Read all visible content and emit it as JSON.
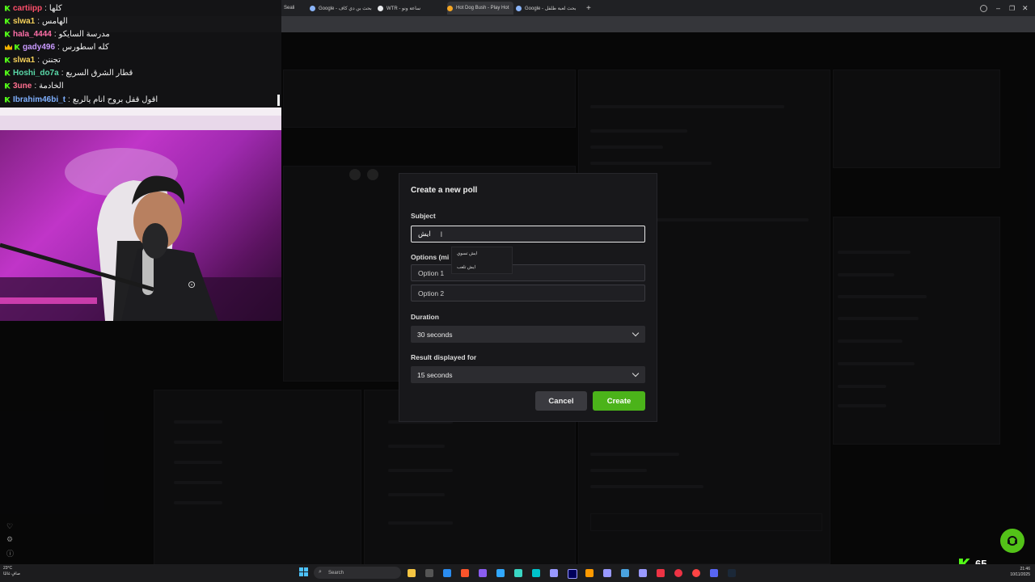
{
  "browser": {
    "tabs": [
      {
        "label": "Google - بحث بن دي كاف"
      },
      {
        "label": "WTR - ساعة ونو"
      },
      {
        "label": "Hot Dog Bush - Play Hot"
      },
      {
        "label": "Google - بحث لعبة طلقل"
      }
    ],
    "partial_tab": "Seali",
    "new_tab_symbol": "+"
  },
  "stream_chat": {
    "messages": [
      {
        "user": "cartiipp",
        "user_color": "#ff4f6b",
        "text": "كلها",
        "badges": [
          "kick"
        ]
      },
      {
        "user": "slwa1",
        "user_color": "#f6d25a",
        "text": "الهامس",
        "badges": [
          "kick"
        ]
      },
      {
        "user": "hala_4444",
        "user_color": "#ff6fa8",
        "text": "مدرسة السايكو",
        "badges": [
          "kick"
        ]
      },
      {
        "user": "gady496",
        "user_color": "#c99aff",
        "text": "كله اسطورس",
        "badges": [
          "crown",
          "kick"
        ]
      },
      {
        "user": "slwa1",
        "user_color": "#f6d25a",
        "text": "تجننن",
        "badges": [
          "kick"
        ]
      },
      {
        "user": "Hoshi_do7a",
        "user_color": "#59d8a8",
        "text": "قطار الشرق السريع",
        "badges": [
          "kick"
        ]
      },
      {
        "user": "3une",
        "user_color": "#ff6f8f",
        "text": "الخادمة",
        "badges": [
          "kick"
        ]
      },
      {
        "user": "Ibrahim46bi_t",
        "user_color": "#7fb0ff",
        "text": "اقول قفل بروح انام يالربع",
        "badges": [
          "kick"
        ]
      }
    ]
  },
  "poll_modal": {
    "title": "Create a new poll",
    "subject_label": "Subject",
    "subject_value": "ايش",
    "options_label": "Options (mi",
    "option1_placeholder": "Option 1",
    "option2_placeholder": "Option 2",
    "duration_label": "Duration",
    "duration_value": "30 seconds",
    "result_label": "Result displayed for",
    "result_value": "15 seconds",
    "cancel_label": "Cancel",
    "create_label": "Create"
  },
  "autocomplete": {
    "items": [
      "ايش تسوي",
      "ايش تلعب"
    ]
  },
  "taskbar": {
    "search_placeholder": "Search",
    "weather": "23°C",
    "weather_sub": "صافٍ غالبًا",
    "viewer_count": "65",
    "time": "21:46",
    "date": "10/11/2025"
  },
  "colors": {
    "kick_green": "#53fc18",
    "create_button": "#4bb31a",
    "modal_bg": "#18181b"
  },
  "icons": [
    "kick-icon",
    "crown-icon",
    "chevron-down-icon",
    "windows-start-icon",
    "search-icon",
    "support-icon",
    "heart-icon",
    "settings-icon"
  ]
}
